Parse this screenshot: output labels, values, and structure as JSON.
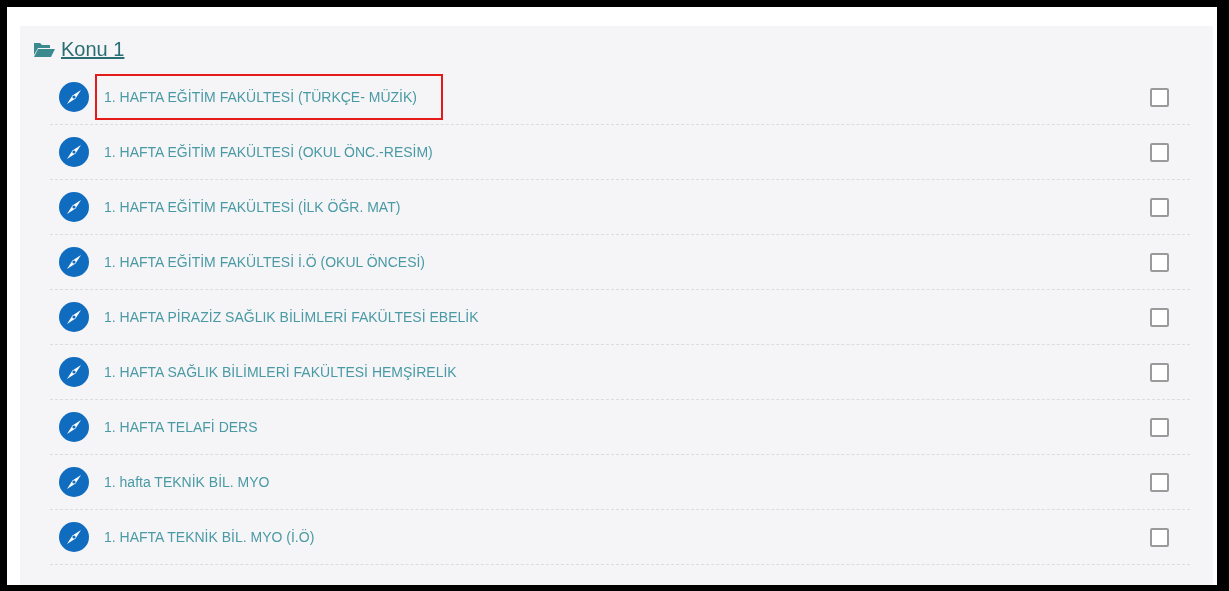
{
  "section": {
    "title": "Konu 1"
  },
  "activities": [
    {
      "label": "1. HAFTA EĞİTİM FAKÜLTESİ (TÜRKÇE- MÜZİK)",
      "highlighted": true,
      "checked": false
    },
    {
      "label": "1. HAFTA EĞİTİM FAKÜLTESİ (OKUL ÖNC.-RESİM)",
      "highlighted": false,
      "checked": false
    },
    {
      "label": "1. HAFTA EĞİTİM FAKÜLTESİ (İLK ÖĞR. MAT)",
      "highlighted": false,
      "checked": false
    },
    {
      "label": "1. HAFTA EĞİTİM FAKÜLTESİ İ.Ö (OKUL ÖNCESİ)",
      "highlighted": false,
      "checked": false
    },
    {
      "label": "1. HAFTA PİRAZİZ SAĞLIK BİLİMLERİ FAKÜLTESİ EBELİK",
      "highlighted": false,
      "checked": false
    },
    {
      "label": "1. HAFTA SAĞLIK BİLİMLERİ FAKÜLTESİ HEMŞİRELİK",
      "highlighted": false,
      "checked": false
    },
    {
      "label": "1. HAFTA TELAFİ DERS",
      "highlighted": false,
      "checked": false
    },
    {
      "label": "1. hafta TEKNİK BİL. MYO",
      "highlighted": false,
      "checked": false
    },
    {
      "label": "1. HAFTA TEKNİK BİL. MYO (İ.Ö)",
      "highlighted": false,
      "checked": false
    }
  ]
}
